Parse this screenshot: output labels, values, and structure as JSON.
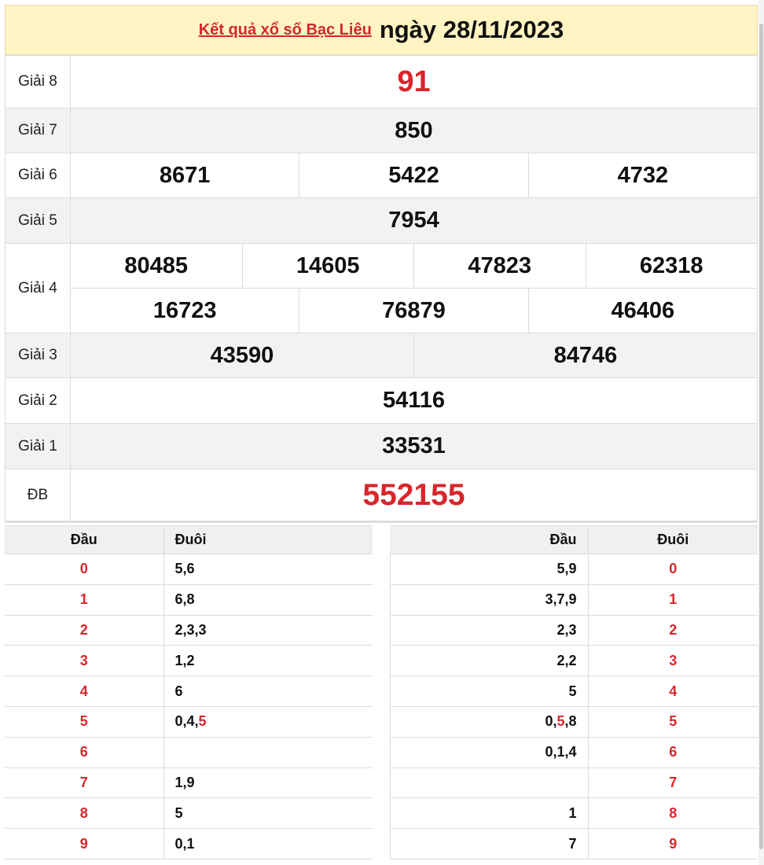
{
  "header": {
    "link_text": "Kết quả xổ số Bạc Liêu",
    "date_text": "ngày 28/11/2023"
  },
  "prizes": {
    "g8": {
      "label": "Giải 8",
      "values": [
        "91"
      ]
    },
    "g7": {
      "label": "Giải 7",
      "values": [
        "850"
      ]
    },
    "g6": {
      "label": "Giải 6",
      "values": [
        "8671",
        "5422",
        "4732"
      ]
    },
    "g5": {
      "label": "Giải 5",
      "values": [
        "7954"
      ]
    },
    "g4": {
      "label": "Giải 4",
      "row1": [
        "80485",
        "14605",
        "47823",
        "62318"
      ],
      "row2": [
        "16723",
        "76879",
        "46406"
      ]
    },
    "g3": {
      "label": "Giải 3",
      "values": [
        "43590",
        "84746"
      ]
    },
    "g2": {
      "label": "Giải 2",
      "values": [
        "54116"
      ]
    },
    "g1": {
      "label": "Giải 1",
      "values": [
        "33531"
      ]
    },
    "db": {
      "label": "ĐB",
      "values": [
        "552155"
      ]
    }
  },
  "dau_duoi_left": {
    "headers": [
      "Đầu",
      "Đuôi"
    ],
    "rows": [
      {
        "head": "0",
        "tail": "5,6"
      },
      {
        "head": "1",
        "tail": "6,8"
      },
      {
        "head": "2",
        "tail": "2,3,3"
      },
      {
        "head": "3",
        "tail": "1,2"
      },
      {
        "head": "4",
        "tail": "6"
      },
      {
        "head": "5",
        "tail_pre": "0,4,",
        "tail_hl": "5"
      },
      {
        "head": "6",
        "tail": ""
      },
      {
        "head": "7",
        "tail": "1,9"
      },
      {
        "head": "8",
        "tail": "5"
      },
      {
        "head": "9",
        "tail": "0,1"
      }
    ]
  },
  "dau_duoi_right": {
    "headers": [
      "Đầu",
      "Đuôi"
    ],
    "rows": [
      {
        "dau": "5,9",
        "duoi": "0"
      },
      {
        "dau": "3,7,9",
        "duoi": "1"
      },
      {
        "dau": "2,3",
        "duoi": "2"
      },
      {
        "dau": "2,2",
        "duoi": "3"
      },
      {
        "dau": "5",
        "duoi": "4"
      },
      {
        "dau_pre": "0,",
        "dau_hl": "5",
        "dau_post": ",8",
        "duoi": "5"
      },
      {
        "dau": "0,1,4",
        "duoi": "6"
      },
      {
        "dau": "",
        "duoi": "7"
      },
      {
        "dau": "1",
        "duoi": "8"
      },
      {
        "dau": "7",
        "duoi": "9"
      }
    ]
  },
  "colors": {
    "accent_red": "#d8262b",
    "header_bg": "#fff4c2",
    "alt_row": "#f2f2f2"
  }
}
